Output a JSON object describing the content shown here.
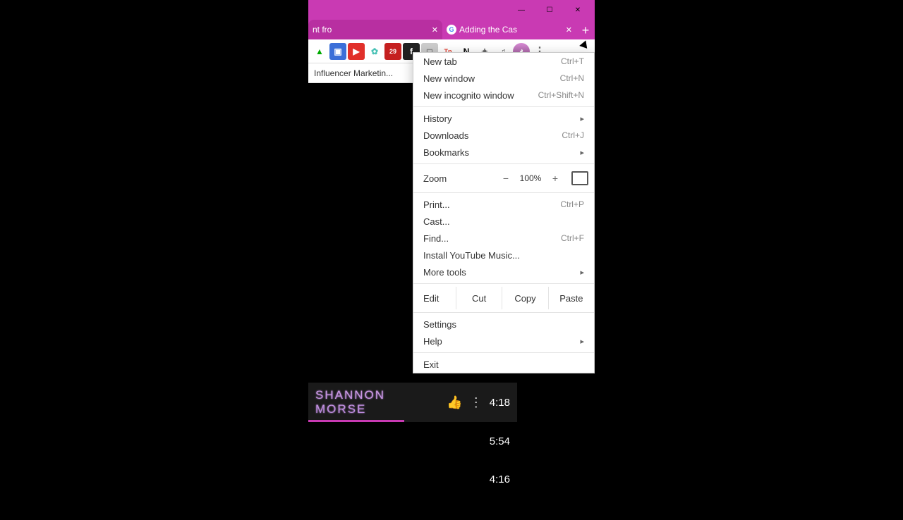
{
  "window": {
    "tabs": [
      {
        "title": "nt fro",
        "active": false
      },
      {
        "title": "Adding the Cas",
        "active": true
      }
    ]
  },
  "bookmarks_bar": {
    "item": "Influencer Marketin..."
  },
  "menu": {
    "group1": [
      {
        "label": "New tab",
        "accel": "Ctrl+T"
      },
      {
        "label": "New window",
        "accel": "Ctrl+N"
      },
      {
        "label": "New incognito window",
        "accel": "Ctrl+Shift+N"
      }
    ],
    "group2": [
      {
        "label": "History",
        "submenu": true
      },
      {
        "label": "Downloads",
        "accel": "Ctrl+J"
      },
      {
        "label": "Bookmarks",
        "submenu": true
      }
    ],
    "zoom": {
      "label": "Zoom",
      "value": "100%"
    },
    "group3": [
      {
        "label": "Print...",
        "accel": "Ctrl+P"
      },
      {
        "label": "Cast..."
      },
      {
        "label": "Find...",
        "accel": "Ctrl+F"
      },
      {
        "label": "Install YouTube Music..."
      },
      {
        "label": "More tools",
        "submenu": true
      }
    ],
    "edit": {
      "label": "Edit",
      "cut": "Cut",
      "copy": "Copy",
      "paste": "Paste"
    },
    "group4": [
      {
        "label": "Settings"
      },
      {
        "label": "Help",
        "submenu": true
      }
    ],
    "exit": {
      "label": "Exit"
    }
  },
  "toolbar_icons": [
    {
      "name": "drive-icon",
      "bg": "#fff",
      "fg": "#0a0",
      "glyph": "▲"
    },
    {
      "name": "ext-blue-icon",
      "bg": "#3b6fd8",
      "fg": "#fff",
      "glyph": "▣"
    },
    {
      "name": "ext-red-icon",
      "bg": "#e1302a",
      "fg": "#fff",
      "glyph": "▶"
    },
    {
      "name": "ext-teal-icon",
      "bg": "#fff",
      "fg": "#47c1b5",
      "glyph": "✿"
    },
    {
      "name": "ext-cal-icon",
      "bg": "#c52020",
      "fg": "#fff",
      "glyph": "29"
    },
    {
      "name": "ext-dark-icon",
      "bg": "#222",
      "fg": "#fff",
      "glyph": "f"
    },
    {
      "name": "ext-grey-icon",
      "bg": "#ccc",
      "fg": "#888",
      "glyph": "◻"
    },
    {
      "name": "ext-tp-icon",
      "bg": "#fff",
      "fg": "#e23b2e",
      "glyph": "Tp"
    },
    {
      "name": "notion-icon",
      "bg": "#fff",
      "fg": "#000",
      "glyph": "N"
    },
    {
      "name": "extensions-icon",
      "bg": "transparent",
      "fg": "#666",
      "glyph": "✦"
    },
    {
      "name": "media-icon",
      "bg": "transparent",
      "fg": "#666",
      "glyph": "♫"
    }
  ],
  "mini_player": {
    "title": "SHANNON MORSE",
    "now": "4:18",
    "rows": [
      "5:54",
      "4:16"
    ]
  }
}
